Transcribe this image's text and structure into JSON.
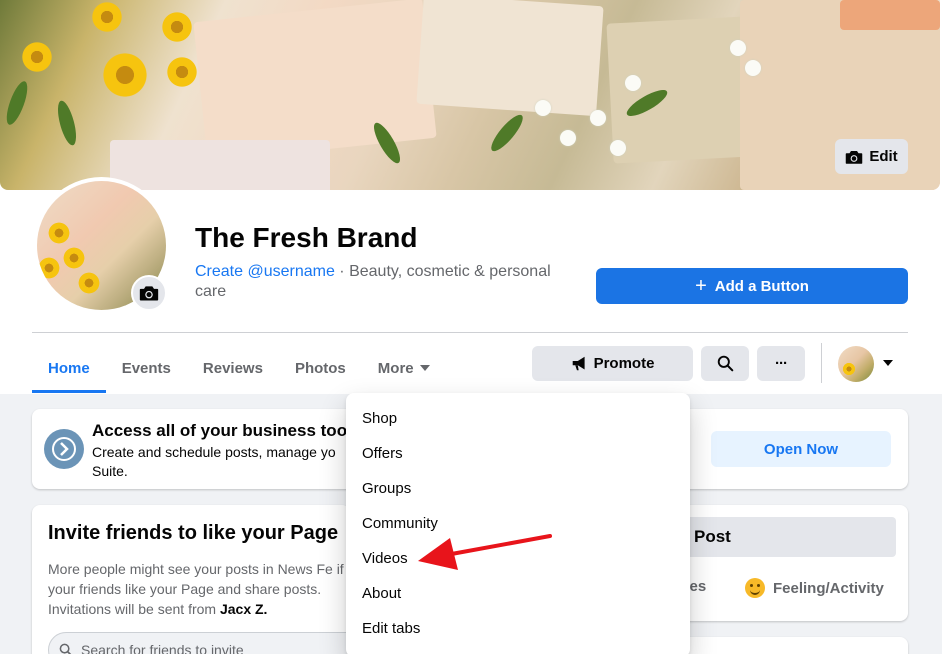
{
  "cover": {
    "edit_label": "Edit"
  },
  "page": {
    "name": "The Fresh Brand",
    "username_link": "Create @username",
    "separator": " · ",
    "category": "Beauty, cosmetic & personal care"
  },
  "actions": {
    "add_button": "Add a Button",
    "add_icon": "+",
    "promote": "Promote",
    "search_icon": "search-icon",
    "more_icon": "···"
  },
  "tabs": [
    {
      "label": "Home",
      "active": true
    },
    {
      "label": "Events"
    },
    {
      "label": "Reviews"
    },
    {
      "label": "Photos"
    },
    {
      "label": "More"
    }
  ],
  "business_card": {
    "title": "Access all of your business tools i",
    "description": "Create and schedule posts, manage yo Suite.",
    "button": "Open Now"
  },
  "invite_card": {
    "title": "Invite friends to like your Page",
    "description": "More people might see your posts in News Fe if your friends like your Page and share posts. Invitations will be sent from ",
    "sender": "Jacx Z.",
    "sender_suffix": ".",
    "search_placeholder": "Search for friends to invite"
  },
  "post_card": {
    "field_label": "Post",
    "option_images": "ages",
    "option_feeling": "Feeling/Activity"
  },
  "more_dropdown": {
    "items": [
      "Shop",
      "Offers",
      "Groups",
      "Community",
      "Videos",
      "About",
      "Edit tabs"
    ],
    "highlighted": "Videos"
  },
  "colors": {
    "accent": "#1877f2",
    "annotation_arrow": "#e8141b"
  }
}
